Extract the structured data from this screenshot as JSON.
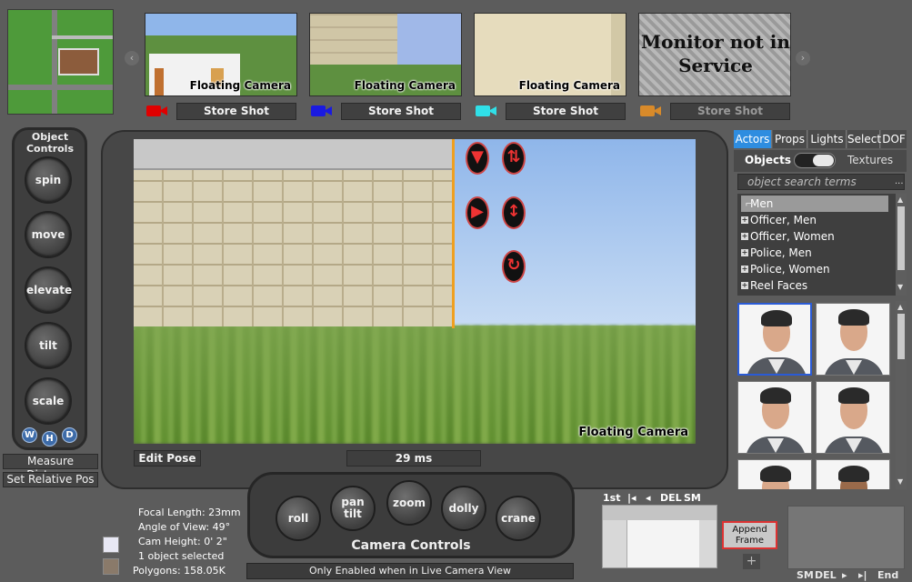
{
  "thumbnails": [
    {
      "caption": "Floating Camera",
      "store_label": "Store Shot",
      "cam_color": "#e00000"
    },
    {
      "caption": "Floating Camera",
      "store_label": "Store Shot",
      "cam_color": "#1a1ae0"
    },
    {
      "caption": "Floating Camera",
      "store_label": "Store Shot",
      "cam_color": "#30e0e8"
    },
    {
      "caption": "Monitor not in Service",
      "store_label": "Store Shot",
      "cam_color": "#d88a2a"
    }
  ],
  "object_controls": {
    "title": "Object Controls",
    "buttons": [
      "spin",
      "move",
      "elevate",
      "tilt",
      "scale"
    ],
    "modes": [
      "W",
      "H",
      "D"
    ]
  },
  "side_buttons": {
    "measure": "Measure Distance",
    "set_relative": "Set Relative Pos"
  },
  "view": {
    "caption": "Floating Camera",
    "edit_pose": "Edit Pose",
    "frame_time": "29 ms"
  },
  "right_panel": {
    "tabs": [
      "Actors",
      "Props",
      "Lights",
      "Select",
      "DOF"
    ],
    "active_tab": "Actors",
    "toggle_left": "Objects",
    "toggle_right": "Textures",
    "search_placeholder": "object search terms",
    "search_button": "...",
    "tree": [
      "Men",
      "Officer, Men",
      "Officer, Women",
      "Police, Men",
      "Police, Women",
      "Reel Faces"
    ]
  },
  "info": {
    "focal_length": "Focal Length: 23mm",
    "angle_of_view": "Angle of View: 49°",
    "cam_height": "Cam Height: 0' 2\"",
    "selected": "1 object selected",
    "polygons": "Polygons: 158.05K"
  },
  "camera_controls": {
    "title": "Camera Controls",
    "buttons": [
      "roll",
      "pan tilt",
      "zoom",
      "dolly",
      "crane"
    ],
    "note": "Only Enabled when in Live Camera View"
  },
  "frames": {
    "top_controls": [
      "1st",
      "|◂",
      "◂",
      "DEL",
      "SM"
    ],
    "append": "Append Frame",
    "add": "+",
    "bottom_controls": [
      "SM",
      "DEL",
      "▸",
      "▸|",
      "End"
    ]
  }
}
